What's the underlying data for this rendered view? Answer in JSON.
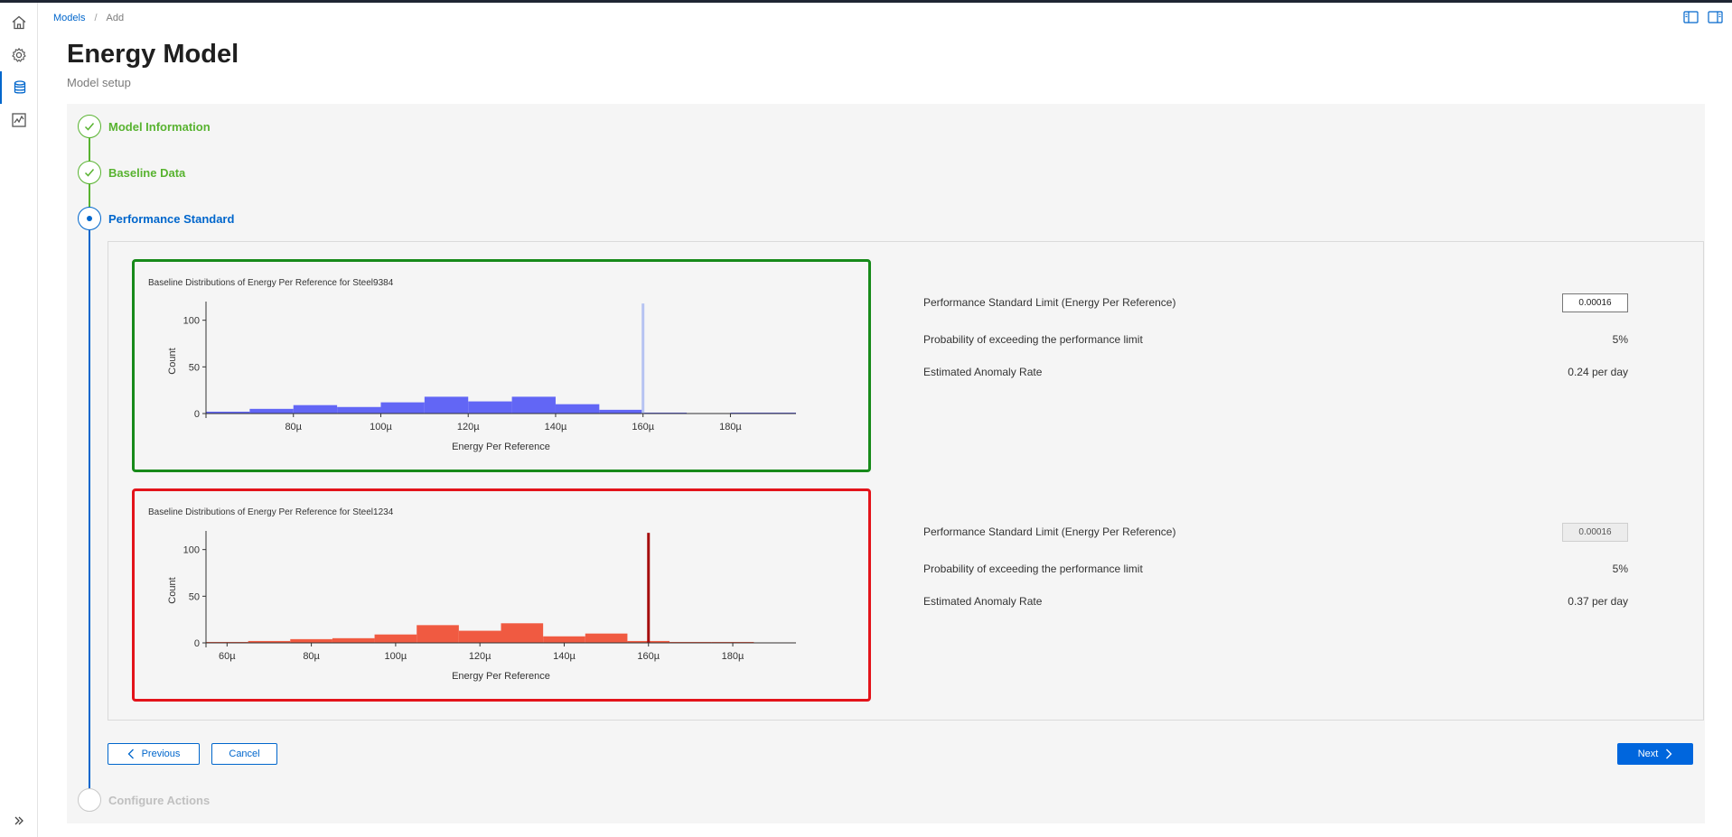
{
  "breadcrumb": {
    "root": "Models",
    "separator": "/",
    "current": "Add"
  },
  "page": {
    "title": "Energy Model",
    "subtitle": "Model setup"
  },
  "steps": [
    {
      "label": "Model Information",
      "state": "done"
    },
    {
      "label": "Baseline Data",
      "state": "done"
    },
    {
      "label": "Performance Standard",
      "state": "current"
    },
    {
      "label": "Configure Actions",
      "state": "todo"
    }
  ],
  "panels": [
    {
      "status": "ok",
      "border_color": "#178a1a",
      "metrics": {
        "limit_label": "Performance Standard Limit (Energy Per Reference)",
        "limit_value": "0.00016",
        "prob_label": "Probability of exceeding the performance limit",
        "prob_value": "5%",
        "rate_label": "Estimated Anomaly Rate",
        "rate_value": "0.24 per day"
      }
    },
    {
      "status": "bad",
      "border_color": "#e3131a",
      "metrics": {
        "limit_label": "Performance Standard Limit (Energy Per Reference)",
        "limit_value": "0.00016",
        "prob_label": "Probability of exceeding the performance limit",
        "prob_value": "5%",
        "rate_label": "Estimated Anomaly Rate",
        "rate_value": "0.37 per day"
      }
    }
  ],
  "chart_data": [
    {
      "type": "bar",
      "title": "Baseline Distributions of Energy Per Reference for Steel9384",
      "xlabel": "Energy Per Reference",
      "ylabel": "Count",
      "xlim": [
        60,
        195
      ],
      "ylim": [
        0,
        120
      ],
      "x_tick_labels": [
        "80µ",
        "100µ",
        "120µ",
        "140µ",
        "160µ",
        "180µ"
      ],
      "x_ticks": [
        80,
        100,
        120,
        140,
        160,
        180
      ],
      "y_tick_labels": [
        "0",
        "50",
        "100"
      ],
      "y_ticks": [
        0,
        50,
        100
      ],
      "bin_edges": [
        60,
        70,
        80,
        90,
        100,
        110,
        120,
        130,
        140,
        150,
        160,
        170,
        180,
        195
      ],
      "values": [
        2,
        5,
        9,
        7,
        12,
        18,
        13,
        18,
        10,
        4,
        1,
        0.5,
        1
      ],
      "bar_color": "#6266f5",
      "limit_line": {
        "x": 160,
        "color": "#b6c3f2"
      }
    },
    {
      "type": "bar",
      "title": "Baseline Distributions of Energy Per Reference for Steel1234",
      "xlabel": "Energy Per Reference",
      "ylabel": "Count",
      "xlim": [
        55,
        195
      ],
      "ylim": [
        0,
        120
      ],
      "x_tick_labels": [
        "60µ",
        "80µ",
        "100µ",
        "120µ",
        "140µ",
        "160µ",
        "180µ"
      ],
      "x_ticks": [
        60,
        80,
        100,
        120,
        140,
        160,
        180
      ],
      "y_tick_labels": [
        "0",
        "50",
        "100"
      ],
      "y_ticks": [
        0,
        50,
        100
      ],
      "bin_edges": [
        55,
        65,
        75,
        85,
        95,
        105,
        115,
        125,
        135,
        145,
        155,
        165,
        175,
        185,
        195
      ],
      "values": [
        1,
        2,
        4,
        5,
        9,
        19,
        13,
        21,
        7,
        10,
        2,
        1,
        1,
        0.5
      ],
      "bar_color": "#f05a41",
      "limit_line": {
        "x": 160,
        "color": "#a50d0d"
      }
    }
  ],
  "buttons": {
    "previous": "Previous",
    "cancel": "Cancel",
    "next": "Next"
  }
}
